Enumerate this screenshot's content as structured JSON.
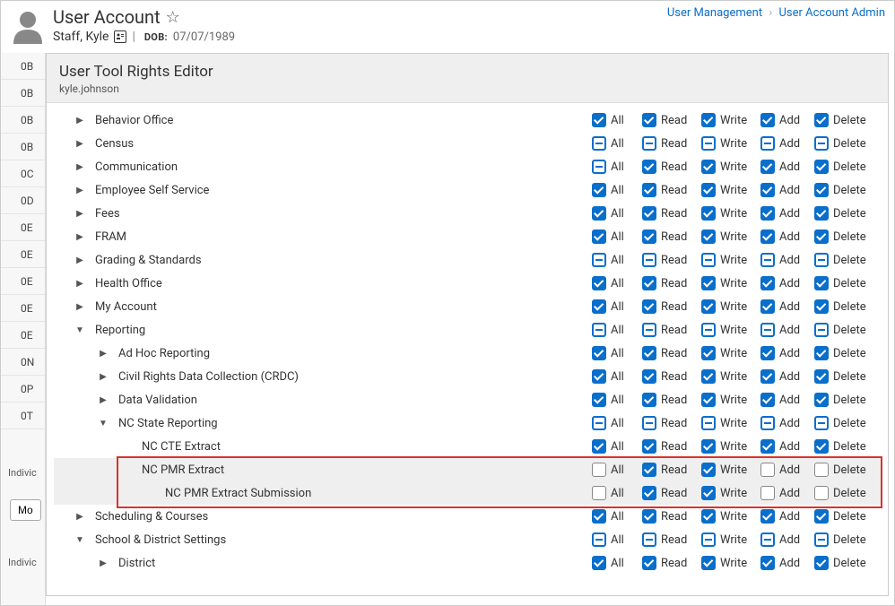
{
  "header": {
    "title": "User Account",
    "star_icon": "☆",
    "person_name": "Staff, Kyle",
    "dob_label": "DOB:",
    "dob": "07/07/1989"
  },
  "breadcrumb": {
    "a": "User Management",
    "b": "User Account Admin"
  },
  "panel": {
    "title": "User Tool Rights Editor",
    "username": "kyle.johnson"
  },
  "leftRail": {
    "items": [
      "0B",
      "0B",
      "0B",
      "0B",
      "0C",
      "0D",
      "0E",
      "0E",
      "0E",
      "0E",
      "0E",
      "0N",
      "0P",
      "0T"
    ],
    "indiv": "Indivic",
    "btn": "Mo"
  },
  "permLabels": {
    "all": "All",
    "read": "Read",
    "write": "Write",
    "add": "Add",
    "delete": "Delete"
  },
  "rows": [
    {
      "label": "Behavior Office",
      "indent": 0,
      "toggle": "right",
      "perms": [
        "c",
        "c",
        "c",
        "c",
        "c"
      ]
    },
    {
      "label": "Census",
      "indent": 0,
      "toggle": "right",
      "perms": [
        "p",
        "p",
        "p",
        "p",
        "p"
      ]
    },
    {
      "label": "Communication",
      "indent": 0,
      "toggle": "right",
      "perms": [
        "p",
        "c",
        "c",
        "c",
        "c"
      ]
    },
    {
      "label": "Employee Self Service",
      "indent": 0,
      "toggle": "right",
      "perms": [
        "c",
        "c",
        "c",
        "c",
        "c"
      ]
    },
    {
      "label": "Fees",
      "indent": 0,
      "toggle": "right",
      "perms": [
        "c",
        "c",
        "c",
        "c",
        "c"
      ]
    },
    {
      "label": "FRAM",
      "indent": 0,
      "toggle": "right",
      "perms": [
        "c",
        "c",
        "c",
        "c",
        "c"
      ]
    },
    {
      "label": "Grading & Standards",
      "indent": 0,
      "toggle": "right",
      "perms": [
        "p",
        "p",
        "p",
        "p",
        "p"
      ]
    },
    {
      "label": "Health Office",
      "indent": 0,
      "toggle": "right",
      "perms": [
        "c",
        "c",
        "c",
        "c",
        "c"
      ]
    },
    {
      "label": "My Account",
      "indent": 0,
      "toggle": "right",
      "perms": [
        "c",
        "c",
        "c",
        "c",
        "c"
      ]
    },
    {
      "label": "Reporting",
      "indent": 0,
      "toggle": "down",
      "perms": [
        "p",
        "p",
        "p",
        "p",
        "p"
      ]
    },
    {
      "label": "Ad Hoc Reporting",
      "indent": 1,
      "toggle": "right",
      "perms": [
        "c",
        "c",
        "c",
        "c",
        "c"
      ]
    },
    {
      "label": "Civil Rights Data Collection (CRDC)",
      "indent": 1,
      "toggle": "right",
      "perms": [
        "c",
        "c",
        "c",
        "c",
        "c"
      ]
    },
    {
      "label": "Data Validation",
      "indent": 1,
      "toggle": "right",
      "perms": [
        "c",
        "c",
        "c",
        "c",
        "c"
      ]
    },
    {
      "label": "NC State Reporting",
      "indent": 1,
      "toggle": "down",
      "perms": [
        "p",
        "p",
        "p",
        "p",
        "p"
      ]
    },
    {
      "label": "NC CTE Extract",
      "indent": 2,
      "toggle": "none",
      "perms": [
        "c",
        "c",
        "c",
        "c",
        "c"
      ]
    },
    {
      "label": "NC PMR Extract",
      "indent": 2,
      "toggle": "none",
      "perms": [
        "u",
        "c",
        "c",
        "u",
        "u"
      ],
      "hl": true
    },
    {
      "label": "NC PMR Extract Submission",
      "indent": 3,
      "toggle": "none",
      "perms": [
        "u",
        "c",
        "c",
        "u",
        "u"
      ],
      "hl": true
    },
    {
      "label": "Scheduling & Courses",
      "indent": 0,
      "toggle": "right",
      "perms": [
        "c",
        "c",
        "c",
        "c",
        "c"
      ]
    },
    {
      "label": "School & District Settings",
      "indent": 0,
      "toggle": "down",
      "perms": [
        "p",
        "p",
        "p",
        "p",
        "p"
      ]
    },
    {
      "label": "District",
      "indent": 1,
      "toggle": "right",
      "perms": [
        "c",
        "c",
        "c",
        "c",
        "c"
      ]
    }
  ]
}
